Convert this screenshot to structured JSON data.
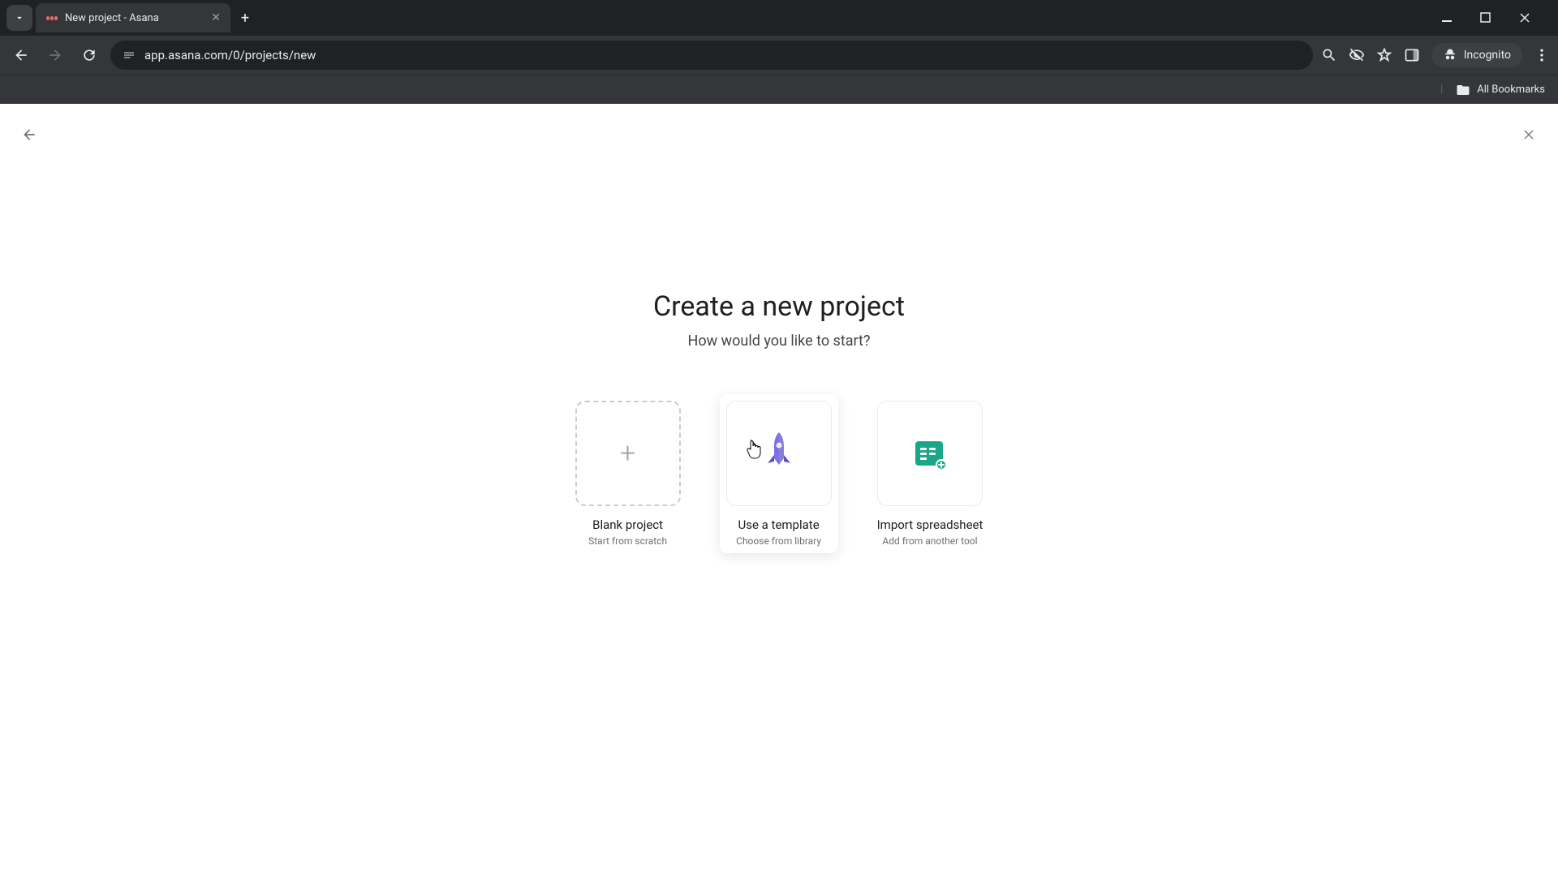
{
  "browser": {
    "tab_title": "New project - Asana",
    "url": "app.asana.com/0/projects/new",
    "incognito_label": "Incognito",
    "bookmarks_label": "All Bookmarks"
  },
  "page": {
    "heading": "Create a new project",
    "subheading": "How would you like to start?",
    "cards": [
      {
        "title": "Blank project",
        "subtitle": "Start from scratch"
      },
      {
        "title": "Use a template",
        "subtitle": "Choose from library"
      },
      {
        "title": "Import spreadsheet",
        "subtitle": "Add from another tool"
      }
    ]
  }
}
